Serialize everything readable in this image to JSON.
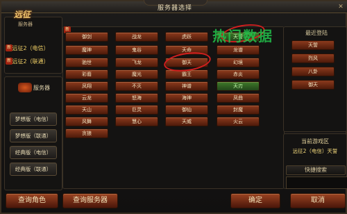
{
  "window": {
    "title": "服务器选择",
    "close_icon": "close-icon"
  },
  "left": {
    "logo_text": "远征",
    "logo_sub": "服务器",
    "items": [
      {
        "label": "远征2（电信）",
        "badge": "新"
      },
      {
        "label": "远征2（联通）",
        "badge": "新"
      }
    ],
    "server_section_label": "服务器",
    "categories": [
      "梦想版（电信）",
      "梦想版（联通）",
      "经典版（电信）",
      "经典版（联通）"
    ]
  },
  "grid": {
    "new_badge": "新",
    "columns": [
      [
        "御剑",
        "魔神",
        "驰世",
        "彩裔",
        "凤翔",
        "云龙",
        "天山",
        "风舞",
        "贪狼"
      ],
      [
        "战龙",
        "鬼谷",
        "飞龙",
        "魔光",
        "不灭",
        "怒海",
        "巨灵",
        "慧心"
      ],
      [
        "虎跃",
        "天命",
        "御天",
        "霸王",
        "神谱",
        "海神",
        "御仙",
        "天威"
      ],
      [
        "天誓",
        "龙谱",
        "幻境",
        "赤炎",
        "天刃",
        "凤曲",
        "封魔",
        "火云"
      ]
    ]
  },
  "right": {
    "recent_title": "最近登陆",
    "recent": [
      "天誓",
      "烈风",
      "八卦",
      "御天"
    ],
    "current_title": "当前游戏区",
    "current_value": "远征2（电信）天誓",
    "quick_title": "快捷搜索"
  },
  "bottom": {
    "query_role": "查询角色",
    "query_server": "查询服务器",
    "confirm": "确定",
    "cancel": "取消"
  },
  "watermark": "热门数据",
  "colors": {
    "accent": "#8c3a1d",
    "highlight": "#d21f1f",
    "text": "#f1e3c0"
  }
}
